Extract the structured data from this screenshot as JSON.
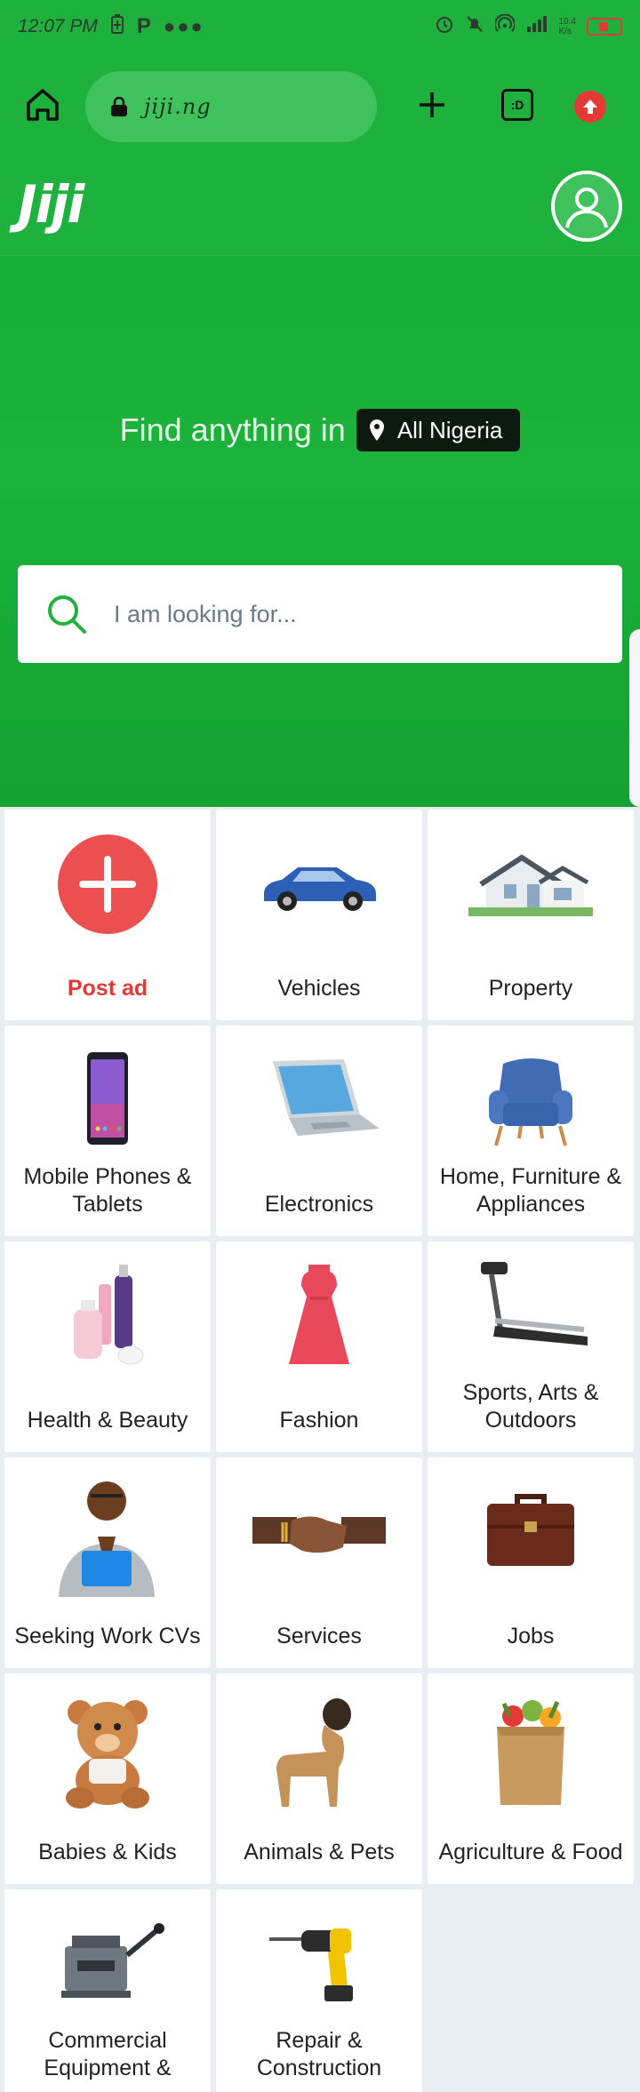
{
  "status_bar": {
    "time": "12:07 PM",
    "speed": "10.4\nK/s"
  },
  "browser": {
    "url": "jiji.ng",
    "tabs_label": ":D"
  },
  "header": {
    "logo": "Jiji"
  },
  "hero": {
    "title": "Find anything in",
    "location": "All Nigeria",
    "search_placeholder": "I am looking for..."
  },
  "categories": [
    {
      "label": "Post ad",
      "icon": "post-ad-icon"
    },
    {
      "label": "Vehicles",
      "icon": "car-icon"
    },
    {
      "label": "Property",
      "icon": "house-icon"
    },
    {
      "label": "Mobile Phones & Tablets",
      "icon": "phone-icon"
    },
    {
      "label": "Electronics",
      "icon": "laptop-icon"
    },
    {
      "label": "Home, Furniture & Appliances",
      "icon": "armchair-icon"
    },
    {
      "label": "Health & Beauty",
      "icon": "cosmetics-icon"
    },
    {
      "label": "Fashion",
      "icon": "dress-icon"
    },
    {
      "label": "Sports, Arts & Outdoors",
      "icon": "treadmill-icon"
    },
    {
      "label": "Seeking Work CVs",
      "icon": "job-seeker-icon"
    },
    {
      "label": "Services",
      "icon": "handshake-icon"
    },
    {
      "label": "Jobs",
      "icon": "briefcase-icon"
    },
    {
      "label": "Babies & Kids",
      "icon": "teddy-bear-icon"
    },
    {
      "label": "Animals & Pets",
      "icon": "dog-icon"
    },
    {
      "label": "Agriculture & Food",
      "icon": "grocery-bag-icon"
    },
    {
      "label": "Commercial Equipment &",
      "icon": "pasta-machine-icon"
    },
    {
      "label": "Repair & Construction",
      "icon": "drill-icon"
    }
  ],
  "colors": {
    "brand_green": "#1fb13e",
    "post_red": "#e53935"
  }
}
